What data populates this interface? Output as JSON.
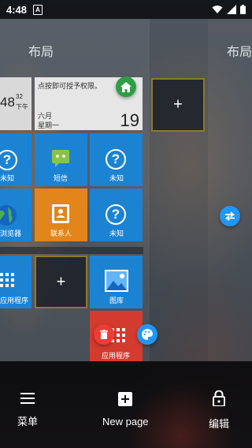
{
  "status_bar": {
    "time": "4:48",
    "notification_glyph": "A"
  },
  "page_titles": {
    "left": "布局",
    "right": "布局"
  },
  "tiles": {
    "clock": {
      "time": "48",
      "superscript": "32",
      "ampm": "下午"
    },
    "calendar": {
      "permission_text": "点按即可授予权限。",
      "month": "六月",
      "weekday": "星期一",
      "day": "19"
    },
    "unknown_label": "未知",
    "sms_label": "短信",
    "browser_label": "浏览器",
    "contacts_label": "联系人",
    "apps_label": "应用程序",
    "gallery_label": "图库",
    "add_glyph": "+"
  },
  "actions": {
    "menu": "菜单",
    "new_page": "New page",
    "edit": "编辑"
  },
  "colors": {
    "tile_blue": "#1c83d2",
    "tile_orange": "#e2851a",
    "tile_red": "#d33b2f",
    "home_badge": "#2e9e44",
    "fab_blue": "#2196f3",
    "fab_red": "#ef3b37"
  },
  "icons": [
    "home-icon",
    "swap-icon",
    "trash-icon",
    "palette-icon",
    "menu-icon",
    "add-box-icon",
    "lock-icon"
  ]
}
